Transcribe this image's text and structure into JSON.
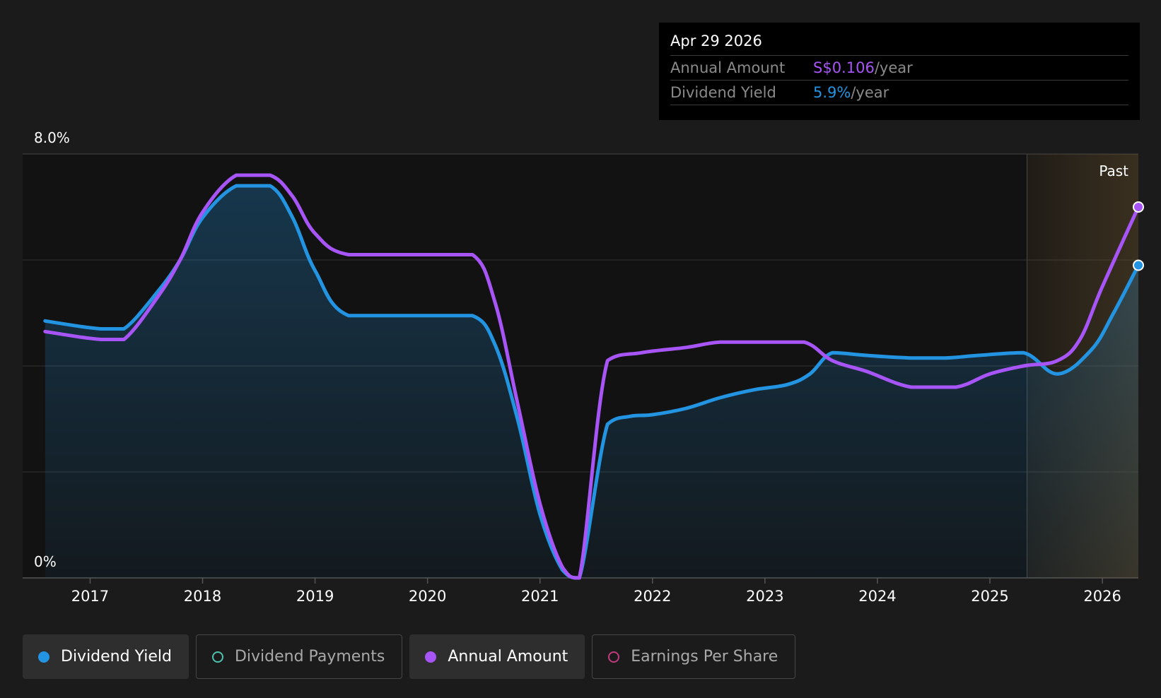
{
  "tooltip": {
    "date": "Apr 29 2026",
    "rows": [
      {
        "label": "Annual Amount",
        "value": "S$0.106",
        "suffix": "/year",
        "color": "#a855f7"
      },
      {
        "label": "Dividend Yield",
        "value": "5.9%",
        "suffix": "/year",
        "color": "#2394e1"
      }
    ]
  },
  "legend": [
    {
      "label": "Dividend Yield",
      "color": "#2394e1",
      "active": true,
      "icon": "filled-circle"
    },
    {
      "label": "Dividend Payments",
      "color": "#4ec2b0",
      "active": false,
      "icon": "hollow-circle"
    },
    {
      "label": "Annual Amount",
      "color": "#a855f7",
      "active": true,
      "icon": "filled-circle"
    },
    {
      "label": "Earnings Per Share",
      "color": "#c03a7e",
      "active": false,
      "icon": "hollow-circle"
    }
  ],
  "chart_data": {
    "type": "line",
    "y_ticks": [
      "8.0%",
      "0%"
    ],
    "ylim": [
      0,
      8
    ],
    "x_ticks": [
      "2017",
      "2018",
      "2019",
      "2020",
      "2021",
      "2022",
      "2023",
      "2024",
      "2025",
      "2026"
    ],
    "xlim": [
      2016.4,
      2026.32
    ],
    "past_label": "Past",
    "past_start": 2025.33,
    "grid": true,
    "series": [
      {
        "name": "Dividend Yield",
        "color": "#2394e1",
        "area": true,
        "points": [
          [
            2016.6,
            4.85
          ],
          [
            2016.9,
            4.75
          ],
          [
            2017.1,
            4.7
          ],
          [
            2017.3,
            4.7
          ],
          [
            2017.6,
            5.4
          ],
          [
            2017.8,
            6.0
          ],
          [
            2018.0,
            6.8
          ],
          [
            2018.3,
            7.4
          ],
          [
            2018.6,
            7.4
          ],
          [
            2018.8,
            6.8
          ],
          [
            2019.0,
            5.8
          ],
          [
            2019.3,
            4.95
          ],
          [
            2020.0,
            4.95
          ],
          [
            2020.4,
            4.95
          ],
          [
            2020.6,
            4.4
          ],
          [
            2020.8,
            3.0
          ],
          [
            2021.0,
            1.2
          ],
          [
            2021.2,
            0.15
          ],
          [
            2021.35,
            0.0
          ],
          [
            2021.6,
            2.9
          ],
          [
            2021.8,
            3.05
          ],
          [
            2022.0,
            3.08
          ],
          [
            2022.3,
            3.2
          ],
          [
            2022.6,
            3.4
          ],
          [
            2022.9,
            3.55
          ],
          [
            2023.2,
            3.65
          ],
          [
            2023.4,
            3.85
          ],
          [
            2023.6,
            4.25
          ],
          [
            2023.9,
            4.2
          ],
          [
            2024.3,
            4.15
          ],
          [
            2024.6,
            4.15
          ],
          [
            2024.9,
            4.2
          ],
          [
            2025.3,
            4.25
          ],
          [
            2025.6,
            3.85
          ],
          [
            2025.9,
            4.3
          ],
          [
            2026.1,
            5.0
          ],
          [
            2026.32,
            5.9
          ]
        ]
      },
      {
        "name": "Annual Amount",
        "color": "#a855f7",
        "area": false,
        "points": [
          [
            2016.6,
            4.65
          ],
          [
            2016.9,
            4.55
          ],
          [
            2017.1,
            4.5
          ],
          [
            2017.3,
            4.5
          ],
          [
            2017.6,
            5.3
          ],
          [
            2017.8,
            6.0
          ],
          [
            2018.0,
            6.9
          ],
          [
            2018.3,
            7.6
          ],
          [
            2018.6,
            7.6
          ],
          [
            2018.8,
            7.2
          ],
          [
            2019.0,
            6.5
          ],
          [
            2019.3,
            6.1
          ],
          [
            2020.0,
            6.1
          ],
          [
            2020.4,
            6.1
          ],
          [
            2020.6,
            5.2
          ],
          [
            2020.8,
            3.3
          ],
          [
            2021.0,
            1.4
          ],
          [
            2021.2,
            0.2
          ],
          [
            2021.35,
            0.0
          ],
          [
            2021.6,
            4.1
          ],
          [
            2021.9,
            4.25
          ],
          [
            2022.3,
            4.35
          ],
          [
            2022.6,
            4.45
          ],
          [
            2023.0,
            4.45
          ],
          [
            2023.35,
            4.45
          ],
          [
            2023.6,
            4.1
          ],
          [
            2023.9,
            3.9
          ],
          [
            2024.3,
            3.6
          ],
          [
            2024.7,
            3.6
          ],
          [
            2025.0,
            3.85
          ],
          [
            2025.3,
            4.0
          ],
          [
            2025.6,
            4.1
          ],
          [
            2025.8,
            4.5
          ],
          [
            2026.0,
            5.5
          ],
          [
            2026.32,
            7.0
          ]
        ]
      }
    ]
  }
}
